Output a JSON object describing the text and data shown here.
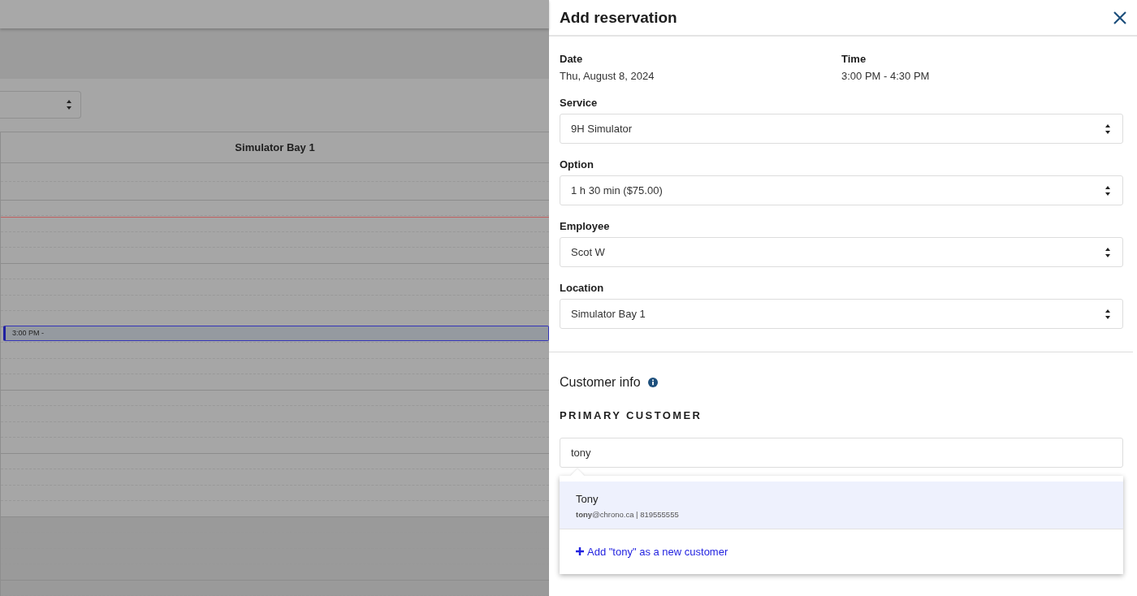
{
  "calendar": {
    "column": "Simulator Bay 1",
    "events": [
      {
        "label": "3:00 PM -"
      }
    ]
  },
  "panel": {
    "title": "Add reservation",
    "summary": [
      {
        "label": "Date",
        "value": "Thu, August 8, 2024"
      },
      {
        "label": "Time",
        "value": "3:00 PM - 4:30 PM"
      }
    ],
    "fields": [
      {
        "label": "Service",
        "value": "9H Simulator"
      },
      {
        "label": "Option",
        "value": "1 h 30 min ($75.00)"
      },
      {
        "label": "Employee",
        "value": "Scot W"
      },
      {
        "label": "Location",
        "value": "Simulator Bay 1"
      }
    ],
    "customer_info": {
      "heading": "Customer info",
      "section": "PRIMARY CUSTOMER",
      "search_value": "tony",
      "results": [
        {
          "name": "Tony",
          "detail": "**tony**@chrono.ca | 819555555",
          "selected": true
        }
      ],
      "add_link": "Add \"tony\" as a new customer"
    }
  }
}
